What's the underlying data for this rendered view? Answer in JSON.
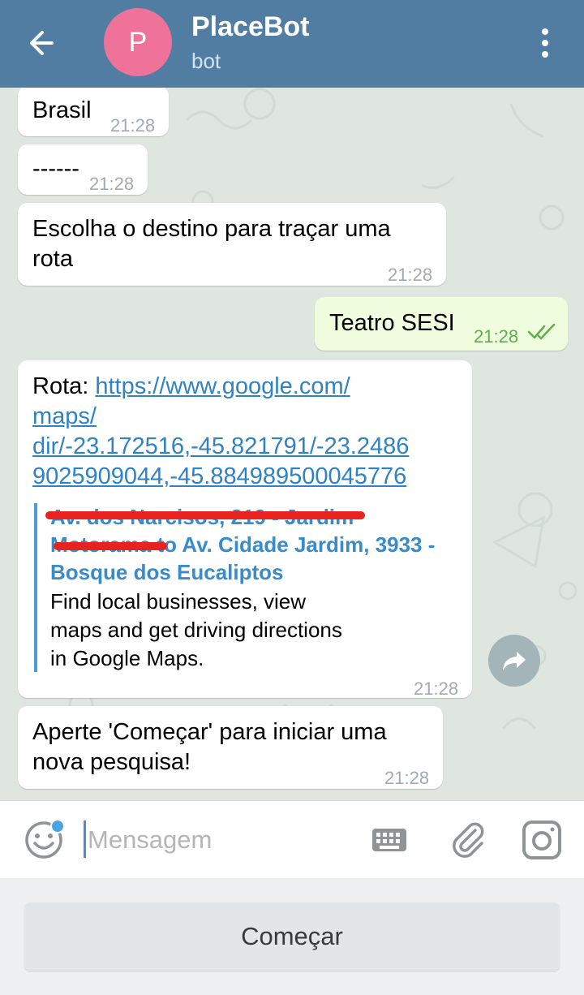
{
  "header": {
    "avatar_letter": "P",
    "avatar_color": "#ef7399",
    "title": "PlaceBot",
    "subtitle": "bot",
    "back_icon": "arrow-left-icon",
    "menu_icon": "more-vertical-icon"
  },
  "messages": [
    {
      "text": "Brasil",
      "time": "21:28"
    },
    {
      "text": "------",
      "time": "21:28"
    },
    {
      "text_line1": "Escolha o destino para traçar uma",
      "text_line2": "rota",
      "time": "21:28"
    },
    {
      "text": "Teatro SESI",
      "time": "21:28",
      "status_icon": "double-check-icon"
    },
    {
      "prefix": "Rota: ",
      "link_line1": "https://www.google.com/",
      "link_line2": "maps/",
      "link_line3": "dir/-23.172516,-45.821791/-23.2486",
      "link_line4": "9025909044,-45.884989500045776",
      "preview_title_line1": "Av. dos Narcisos, 219 - Jardim",
      "preview_title_line2": "Motorama to Av. Cidade Jardim, 3933 -",
      "preview_title_line3": "Bosque dos Eucaliptos",
      "preview_desc_line1": "Find local businesses, view",
      "preview_desc_line2": "maps and get driving directions",
      "preview_desc_line3": "in Google Maps.",
      "time": "21:28"
    },
    {
      "text_line1": "Aperte 'Começar' para iniciar uma",
      "text_line2": "nova pesquisa!",
      "time": "21:28"
    }
  ],
  "composer": {
    "placeholder": "Mensagem",
    "emoji_icon": "emoji-icon",
    "keyboard_icon": "keyboard-icon",
    "attach_icon": "paperclip-icon",
    "camera_icon": "camera-icon"
  },
  "reply_keyboard": {
    "button_label": "Começar"
  },
  "share_icon": "share-icon"
}
